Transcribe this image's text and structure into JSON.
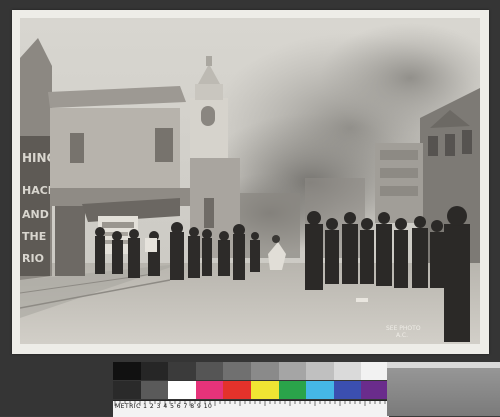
{
  "photo": {
    "subject": "street-fire-crowd",
    "sign_letters": [
      "HING",
      "HACKEL",
      "AND",
      "THE",
      "RIO"
    ],
    "photo_mark": [
      "SEE PHOTO",
      "A.C."
    ]
  },
  "color_bar": {
    "top_swatches": [
      "#111111",
      "#262626",
      "#3b3b3b",
      "#555555",
      "#707070",
      "#8a8a8a",
      "#a5a5a5",
      "#c0c0c0",
      "#dadada",
      "#f2f2f2"
    ],
    "bottom_swatches": [
      "#2a2a2a",
      "#5a5a5a",
      "#ffffff",
      "#e6337a",
      "#e4322b",
      "#f0e533",
      "#2aa44a",
      "#45b7e6",
      "#3b4fb0",
      "#6a2c8c"
    ]
  },
  "ruler": {
    "label": "METRIC 1 2 3 4 5 6 7 8 9 10"
  }
}
